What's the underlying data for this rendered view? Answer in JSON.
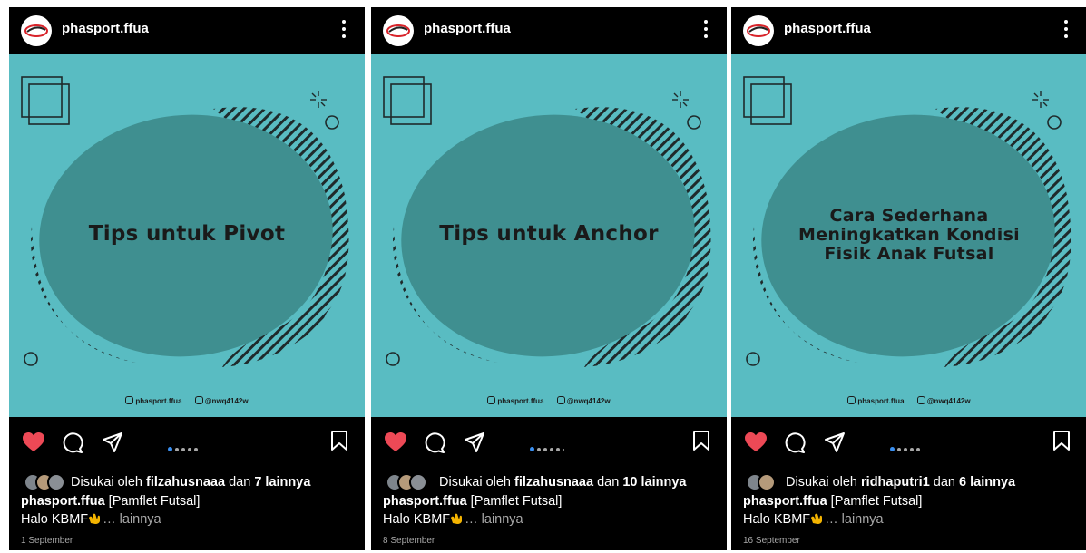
{
  "posts": [
    {
      "username": "phasport.ffua",
      "headline": "Tips untuk Pivot",
      "credit_instagram": "phasport.ffua",
      "credit_line": "@nwq4142w",
      "likes_prefix": "Disukai oleh",
      "likes_user": "filzahusnaaa",
      "likes_join": "dan",
      "likes_others": "7 lainnya",
      "caption_user": "phasport.ffua",
      "caption_text": "[Pamflet Futsal]",
      "caption_line2": "Halo KBMF",
      "more_label": "… lainnya",
      "date": "1 September",
      "carousel_count": 5,
      "carousel_active": 0
    },
    {
      "username": "phasport.ffua",
      "headline": "Tips untuk Anchor",
      "credit_instagram": "phasport.ffua",
      "credit_line": "@nwq4142w",
      "likes_prefix": "Disukai oleh",
      "likes_user": "filzahusnaaa",
      "likes_join": "dan",
      "likes_others": "10 lainnya",
      "caption_user": "phasport.ffua",
      "caption_text": "[Pamflet Futsal]",
      "caption_line2": "Halo KBMF",
      "more_label": "… lainnya",
      "date": "8 September",
      "carousel_count": 6,
      "carousel_active": 0
    },
    {
      "username": "phasport.ffua",
      "headline": "Cara Sederhana Meningkatkan Kondisi Fisik Anak Futsal",
      "credit_instagram": "phasport.ffua",
      "credit_line": "@nwq4142w",
      "likes_prefix": "Disukai oleh",
      "likes_user": "ridhaputri1",
      "likes_join": "dan",
      "likes_others": "6 lainnya",
      "caption_user": "phasport.ffua",
      "caption_text": "[Pamflet Futsal]",
      "caption_line2": "Halo KBMF",
      "more_label": "… lainnya",
      "date": "16 September",
      "carousel_count": 5,
      "carousel_active": 0
    }
  ],
  "colors": {
    "post_background": "#000000",
    "image_background": "#59bcc2",
    "blob": "#3f8f90",
    "liked_heart": "#ed4956",
    "carousel_active": "#3a8ff0"
  }
}
